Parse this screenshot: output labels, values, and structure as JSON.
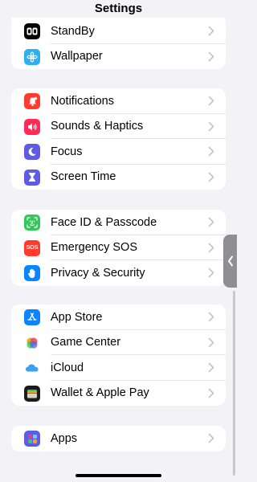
{
  "header": {
    "title": "Settings"
  },
  "groups": [
    {
      "items": [
        {
          "label": "StandBy",
          "icon": "standby-icon",
          "color": "#000000"
        },
        {
          "label": "Wallpaper",
          "icon": "wallpaper-icon",
          "color": "#30b0f0"
        }
      ]
    },
    {
      "items": [
        {
          "label": "Notifications",
          "icon": "notifications-icon",
          "color": "#ff3b30"
        },
        {
          "label": "Sounds & Haptics",
          "icon": "sounds-icon",
          "color": "#ff2d55"
        },
        {
          "label": "Focus",
          "icon": "focus-icon",
          "color": "#5e5ce6"
        },
        {
          "label": "Screen Time",
          "icon": "screen-time-icon",
          "color": "#5e5ce6"
        }
      ]
    },
    {
      "items": [
        {
          "label": "Face ID & Passcode",
          "icon": "faceid-icon",
          "color": "#34c759"
        },
        {
          "label": "Emergency SOS",
          "icon": "sos-icon",
          "color": "#ff3b30",
          "icon_text": "SOS"
        },
        {
          "label": "Privacy & Security",
          "icon": "privacy-icon",
          "color": "#0a84ff"
        }
      ]
    },
    {
      "items": [
        {
          "label": "App Store",
          "icon": "app-store-icon",
          "color": "#0a84ff"
        },
        {
          "label": "Game Center",
          "icon": "game-center-icon",
          "color": "#ffffff"
        },
        {
          "label": "iCloud",
          "icon": "icloud-icon",
          "color": "#ffffff"
        },
        {
          "label": "Wallet & Apple Pay",
          "icon": "wallet-icon",
          "color": "#1c1c1e"
        }
      ]
    },
    {
      "items": [
        {
          "label": "Apps",
          "icon": "apps-icon",
          "color": "#5e5ce6"
        }
      ]
    }
  ]
}
